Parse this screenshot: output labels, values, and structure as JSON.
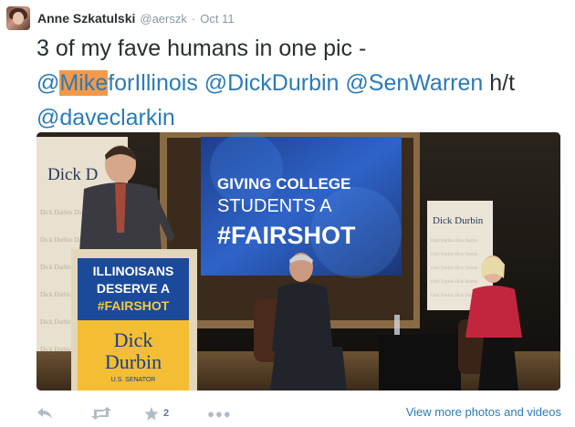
{
  "author": {
    "name": "Anne Szkatulski",
    "handle": "@aerszk",
    "separator": "·",
    "date": "Oct 11"
  },
  "tweet": {
    "line1": "3 of my fave humans in one pic -",
    "mention1_highlight": "Mike",
    "mention1_rest": "forIllinois",
    "mention1_prefix": "@",
    "mention2": "@DickDurbin",
    "mention3": "@SenWarren",
    "ht": "h/t",
    "mention4": "@daveclarkin"
  },
  "photo": {
    "screen_line1": "GIVING COLLEGE",
    "screen_line2": "STUDENTS A",
    "screen_line3": "#FAIRSHOT",
    "podium_line1": "ILLINOISANS",
    "podium_line2": "DESERVE A",
    "podium_line3": "#FAIRSHOT",
    "podium_name1": "Dick",
    "podium_name2": "Durbin",
    "podium_sub": "U.S. SENATOR",
    "banner_left": "Dick D",
    "banner_right": "Dick Durbin"
  },
  "actions": {
    "reply_icon": "reply-icon",
    "retweet_icon": "retweet-icon",
    "favorite_icon": "star-icon",
    "favorite_count": "2",
    "more_icon": "more-icon",
    "view_more": "View more photos and videos"
  },
  "colors": {
    "link": "#2b7bb9",
    "highlight": "#f29a4a",
    "muted": "#8899a6"
  }
}
